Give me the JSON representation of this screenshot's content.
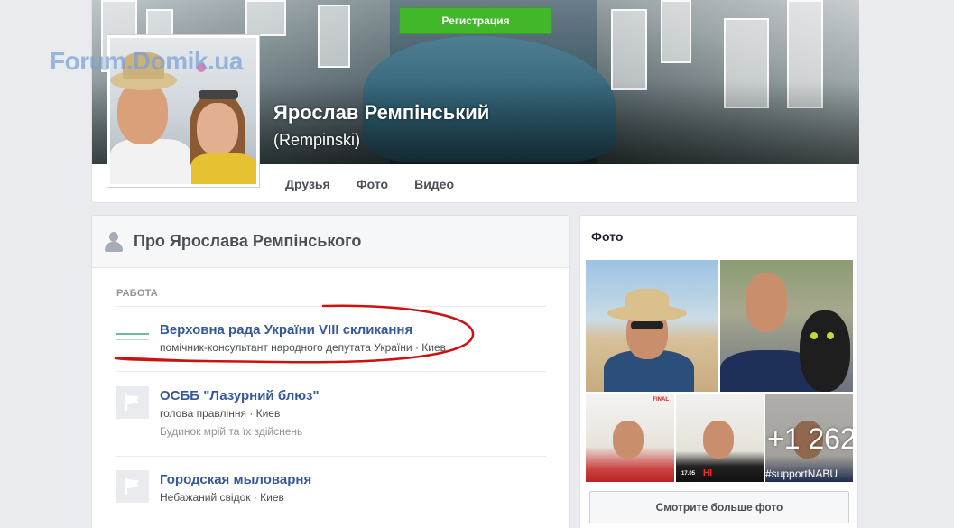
{
  "watermark": "Forum.Domik.ua",
  "header": {
    "register_label": "Регистрация",
    "profile_name": "Ярослав Ремпінський",
    "profile_alt_name": "(Rempinski)",
    "tabs": [
      {
        "label": "Друзья"
      },
      {
        "label": "Фото"
      },
      {
        "label": "Видео"
      }
    ]
  },
  "about": {
    "title": "Про Ярослава Ремпінського",
    "section_label": "РАБОТА",
    "work": [
      {
        "name": "Верховна рада України VIII скликання",
        "subtitle": "помічник-консультант народного депутата України · Киев",
        "description": ""
      },
      {
        "name": "ОСББ \"Лазурний блюз\"",
        "subtitle": "голова правління · Киев",
        "description": "Будинок мрій та їх здійснень"
      },
      {
        "name": "Городская мыловарня",
        "subtitle": "Небажаний свідок · Киев",
        "description": ""
      }
    ]
  },
  "photos": {
    "title": "Фото",
    "more_count": "+1 262",
    "tag_text": "#supportNABU",
    "thumb_labels": [
      "FINAL",
      "17.05",
      "НІ"
    ],
    "more_button": "Смотрите больше фото"
  },
  "colors": {
    "brand_link": "#365899",
    "register_green": "#42b72a",
    "annotation_red": "#cc1111",
    "page_bg": "#e9ebee"
  }
}
